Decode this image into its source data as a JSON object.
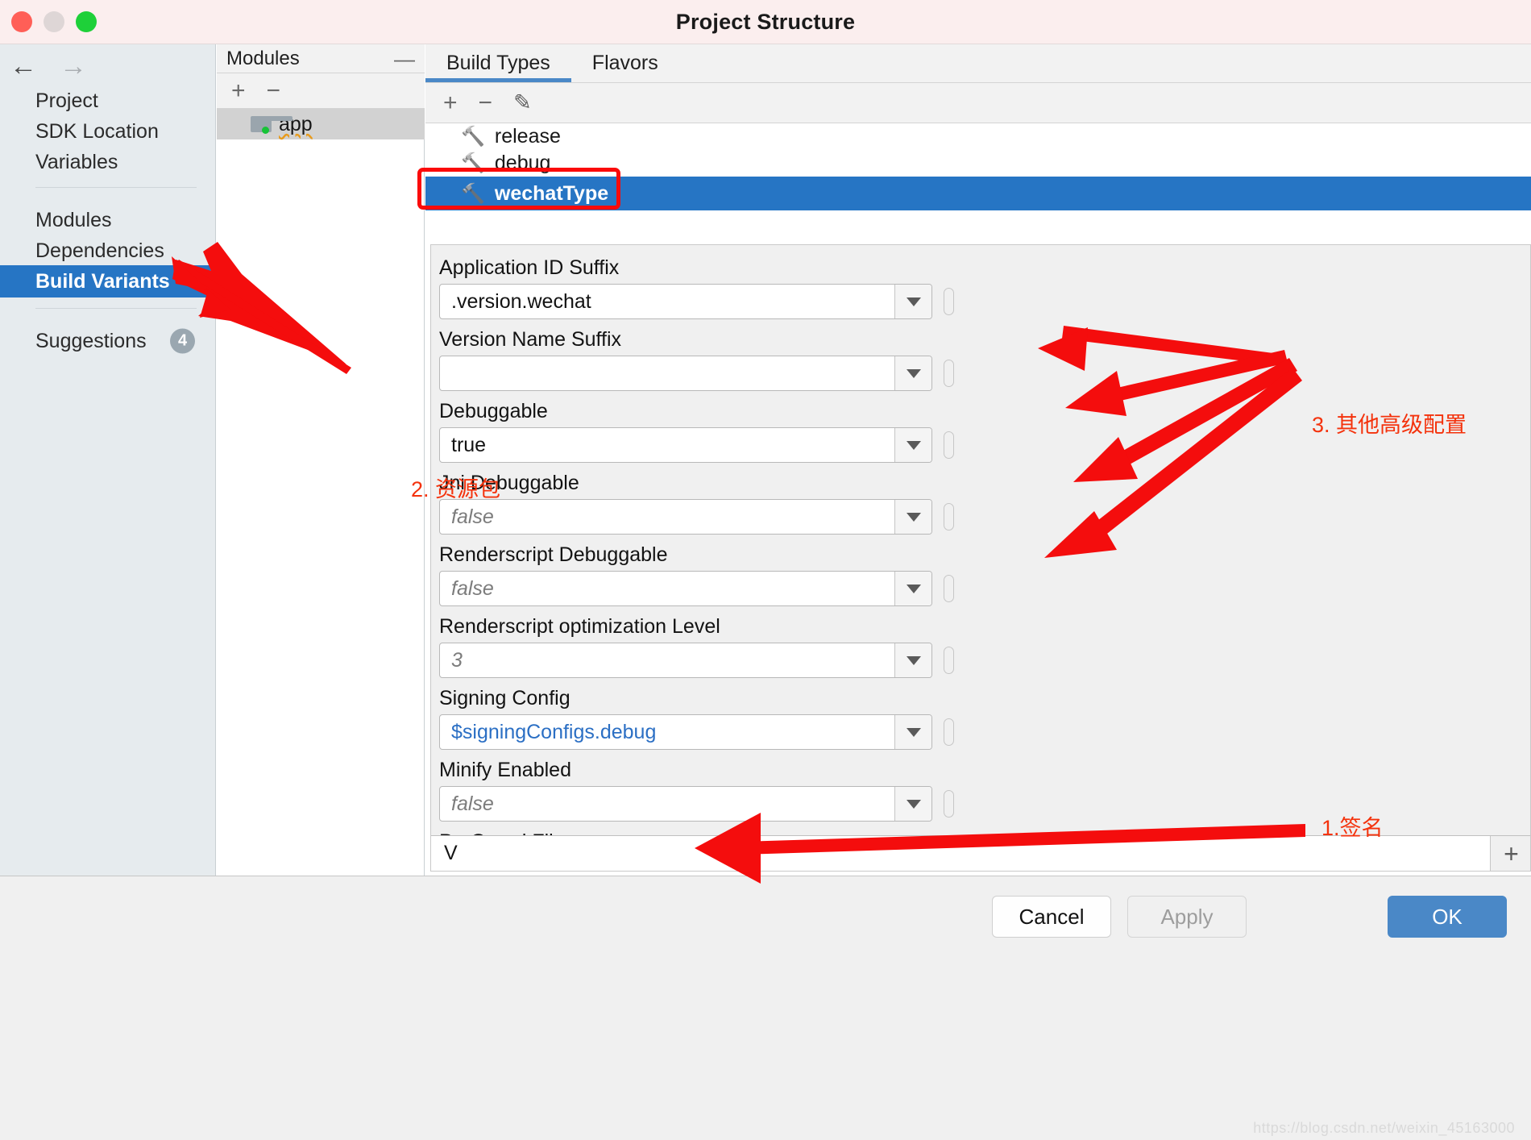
{
  "window": {
    "title": "Project Structure",
    "traffic_lights": [
      "close-red",
      "minimize-amber",
      "zoom-green"
    ]
  },
  "sidebar": {
    "nav": {
      "back": "←",
      "forward": "→"
    },
    "items": [
      {
        "label": "Project",
        "selected": false
      },
      {
        "label": "SDK Location",
        "selected": false
      },
      {
        "label": "Variables",
        "selected": false
      },
      {
        "label": "Modules",
        "selected": false
      },
      {
        "label": "Dependencies",
        "selected": false
      },
      {
        "label": "Build Variants",
        "selected": true
      },
      {
        "label": "Suggestions",
        "selected": false,
        "badge": "4"
      }
    ]
  },
  "modules_panel": {
    "title": "Modules",
    "collapse_label": "—",
    "toolbar": {
      "add": "+",
      "remove": "−"
    },
    "rows": [
      {
        "label": "app",
        "selected": true
      }
    ]
  },
  "content": {
    "tabs": [
      {
        "label": "Build Types",
        "active": true
      },
      {
        "label": "Flavors",
        "active": false
      }
    ],
    "toolbar": {
      "add": "+",
      "remove": "−",
      "edit": "✎"
    },
    "build_types": [
      {
        "label": "release",
        "selected": false
      },
      {
        "label": "debug",
        "selected": false
      },
      {
        "label": "wechatType",
        "selected": true
      }
    ]
  },
  "form": {
    "fields": [
      {
        "label": "Application ID Suffix",
        "value": ".version.wechat",
        "placeholder": false,
        "link": false
      },
      {
        "label": "Version Name Suffix",
        "value": "",
        "placeholder": false,
        "link": false
      },
      {
        "label": "Debuggable",
        "value": "true",
        "placeholder": false,
        "link": false
      },
      {
        "label": "Jni Debuggable",
        "value": "false",
        "placeholder": true,
        "link": false
      },
      {
        "label": "Renderscript Debuggable",
        "value": "false",
        "placeholder": true,
        "link": false
      },
      {
        "label": "Renderscript optimization Level",
        "value": "3",
        "placeholder": true,
        "link": false
      },
      {
        "label": "Signing Config",
        "value": "$signingConfigs.debug",
        "placeholder": false,
        "link": true
      },
      {
        "label": "Minify Enabled",
        "value": "false",
        "placeholder": true,
        "link": false
      },
      {
        "label": "ProGuard Files",
        "value": "V",
        "placeholder": false,
        "link": false
      }
    ],
    "proguard_add": "+"
  },
  "footer": {
    "cancel": "Cancel",
    "apply": "Apply",
    "ok": "OK",
    "watermark": "https://blog.csdn.net/weixin_45163000"
  },
  "annotations": [
    {
      "text": "3. 其他高级配置"
    },
    {
      "text": "2. 资源包"
    },
    {
      "text": "1.签名"
    }
  ],
  "colors": {
    "accent_blue": "#2675c4",
    "ok_blue": "#4a88c7",
    "annotation_red": "#f4320c",
    "highlight_red": "#fb0a0a",
    "link_blue": "#2b6fc4"
  }
}
